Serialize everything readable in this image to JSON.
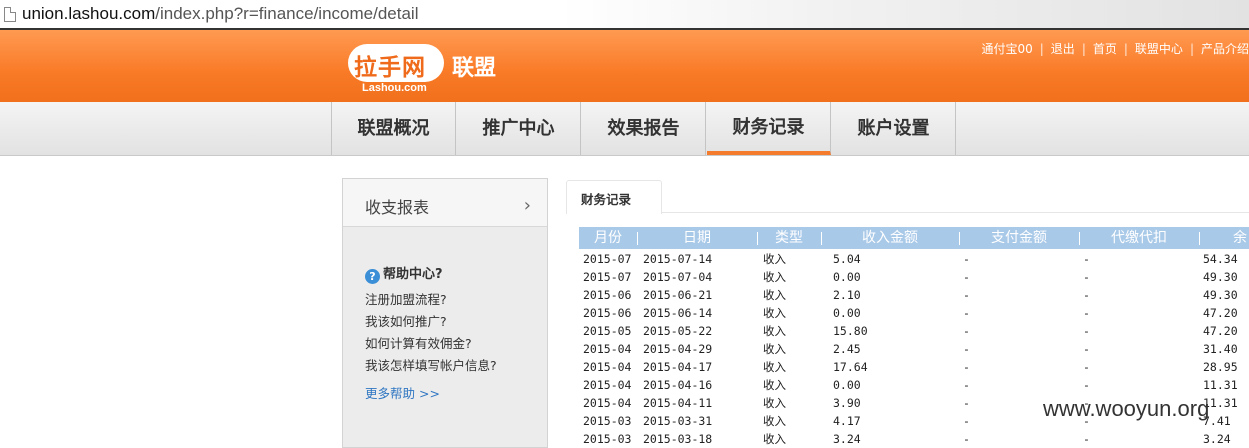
{
  "browser": {
    "url_host": "union.lashou.com",
    "url_path": "/index.php?r=finance/income/detail"
  },
  "header": {
    "logo_text": "拉手网",
    "logo_sub": "Lashou.com",
    "brand": "联盟",
    "top_links": [
      "通付宝00",
      "退出",
      "首页",
      "联盟中心",
      "产品介绍"
    ]
  },
  "nav": {
    "items": [
      {
        "label": "联盟概况"
      },
      {
        "label": "推广中心"
      },
      {
        "label": "效果报告"
      },
      {
        "label": "财务记录"
      },
      {
        "label": "账户设置"
      }
    ],
    "active_index": 3
  },
  "sidebar": {
    "title": "收支报表",
    "help_title": "帮助中心?",
    "help_links": [
      "注册加盟流程?",
      "我该如何推广?",
      "如何计算有效佣金?",
      "我该怎样填写帐户信息?"
    ],
    "more_help": "更多帮助 >>"
  },
  "main": {
    "tab_label": "财务记录",
    "columns": [
      "月份",
      "日期",
      "类型",
      "收入金额",
      "支付金额",
      "代缴代扣",
      "余"
    ],
    "rows": [
      [
        "2015-07",
        "2015-07-14",
        "收入",
        "5.04",
        "-",
        "-",
        "54.34"
      ],
      [
        "2015-07",
        "2015-07-04",
        "收入",
        "0.00",
        "-",
        "-",
        "49.30"
      ],
      [
        "2015-06",
        "2015-06-21",
        "收入",
        "2.10",
        "-",
        "-",
        "49.30"
      ],
      [
        "2015-06",
        "2015-06-14",
        "收入",
        "0.00",
        "-",
        "-",
        "47.20"
      ],
      [
        "2015-05",
        "2015-05-22",
        "收入",
        "15.80",
        "-",
        "-",
        "47.20"
      ],
      [
        "2015-04",
        "2015-04-29",
        "收入",
        "2.45",
        "-",
        "-",
        "31.40"
      ],
      [
        "2015-04",
        "2015-04-17",
        "收入",
        "17.64",
        "-",
        "-",
        "28.95"
      ],
      [
        "2015-04",
        "2015-04-16",
        "收入",
        "0.00",
        "-",
        "-",
        "11.31"
      ],
      [
        "2015-04",
        "2015-04-11",
        "收入",
        "3.90",
        "-",
        "-",
        "11.31"
      ],
      [
        "2015-03",
        "2015-03-31",
        "收入",
        "4.17",
        "-",
        "-",
        "7.41"
      ],
      [
        "2015-03",
        "2015-03-18",
        "收入",
        "3.24",
        "-",
        "-",
        "3.24"
      ]
    ]
  },
  "watermark": "www.wooyun.org",
  "colors": {
    "header_orange": "#f97a26",
    "table_header_blue": "#a9c9e8",
    "link_blue": "#2f76c2"
  }
}
